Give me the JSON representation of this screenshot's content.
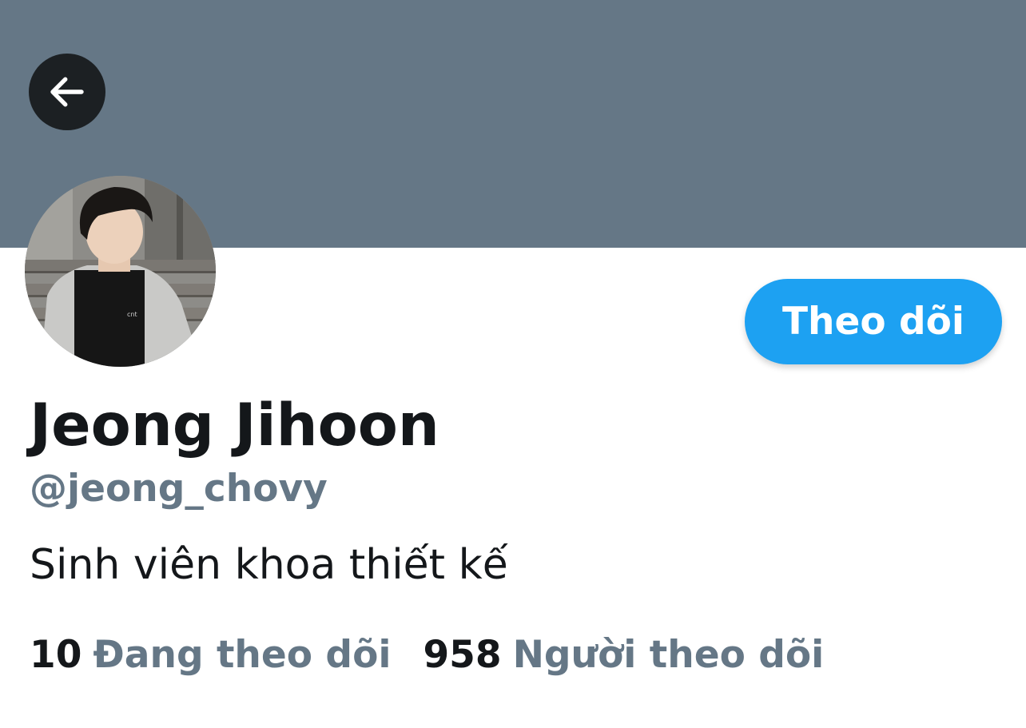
{
  "profile": {
    "display_name": "Jeong Jihoon",
    "handle": "@jeong_chovy",
    "bio": "Sinh viên khoa thiết kế"
  },
  "actions": {
    "follow_label": "Theo dõi"
  },
  "stats": {
    "following_count": "10",
    "following_label": "Đang theo dõi",
    "followers_count": "958",
    "followers_label": "Người theo dõi"
  },
  "icons": {
    "back": "arrow-left-icon"
  },
  "colors": {
    "banner": "#657786",
    "accent": "#1da1f2",
    "text_primary": "#14171a",
    "text_secondary": "#657786",
    "back_button_bg": "#1c2023"
  }
}
